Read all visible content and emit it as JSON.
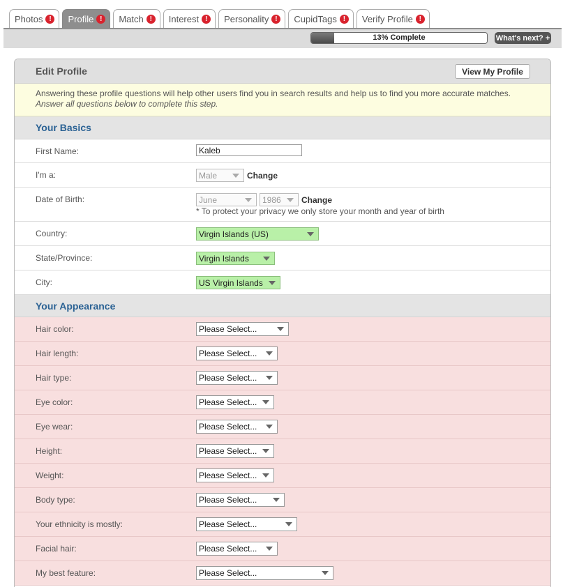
{
  "tabs": [
    {
      "label": "Photos",
      "alert": "!"
    },
    {
      "label": "Profile",
      "alert": "!"
    },
    {
      "label": "Match",
      "alert": "!"
    },
    {
      "label": "Interest",
      "alert": "!"
    },
    {
      "label": "Personality",
      "alert": "!"
    },
    {
      "label": "CupidTags",
      "alert": "!"
    },
    {
      "label": "Verify Profile",
      "alert": "!"
    }
  ],
  "progress": {
    "label": "13% Complete",
    "value": 0.13
  },
  "whats_next": "What's next? +",
  "panel": {
    "title": "Edit Profile",
    "view_button": "View My Profile",
    "notice_line1": "Answering these profile questions will help other users find you in search results and help us to find you more accurate matches.",
    "notice_line2": "Answer all questions below to complete this step."
  },
  "basics": {
    "header": "Your Basics",
    "first_name_label": "First Name:",
    "first_name_value": "Kaleb",
    "gender_label": "I'm a:",
    "gender_value": "Male",
    "change_label": "Change",
    "dob_label": "Date of Birth:",
    "dob_month": "June",
    "dob_year": "1986",
    "privacy_note": "* To protect your privacy we only store your month and year of birth",
    "country_label": "Country:",
    "country_value": "Virgin Islands (US)",
    "state_label": "State/Province:",
    "state_value": "Virgin Islands",
    "city_label": "City:",
    "city_value": "US Virgin Islands"
  },
  "appearance": {
    "header": "Your Appearance",
    "placeholder": "Please Select...",
    "fields": [
      {
        "label": "Hair color:"
      },
      {
        "label": "Hair length:"
      },
      {
        "label": "Hair type:"
      },
      {
        "label": "Eye color:"
      },
      {
        "label": "Eye wear:"
      },
      {
        "label": "Height:"
      },
      {
        "label": "Weight:"
      },
      {
        "label": "Body type:"
      },
      {
        "label": "Your ethnicity is mostly:"
      },
      {
        "label": "Facial hair:"
      },
      {
        "label": "My best feature:"
      }
    ]
  },
  "colors": {
    "tab_active": "#8e8e8e",
    "alert": "#d9232e",
    "section_heading": "#2b6294",
    "location_select": "#b9f0a8",
    "appearance_row": "#f8dfdf",
    "notice_bg": "#fdfde0"
  }
}
